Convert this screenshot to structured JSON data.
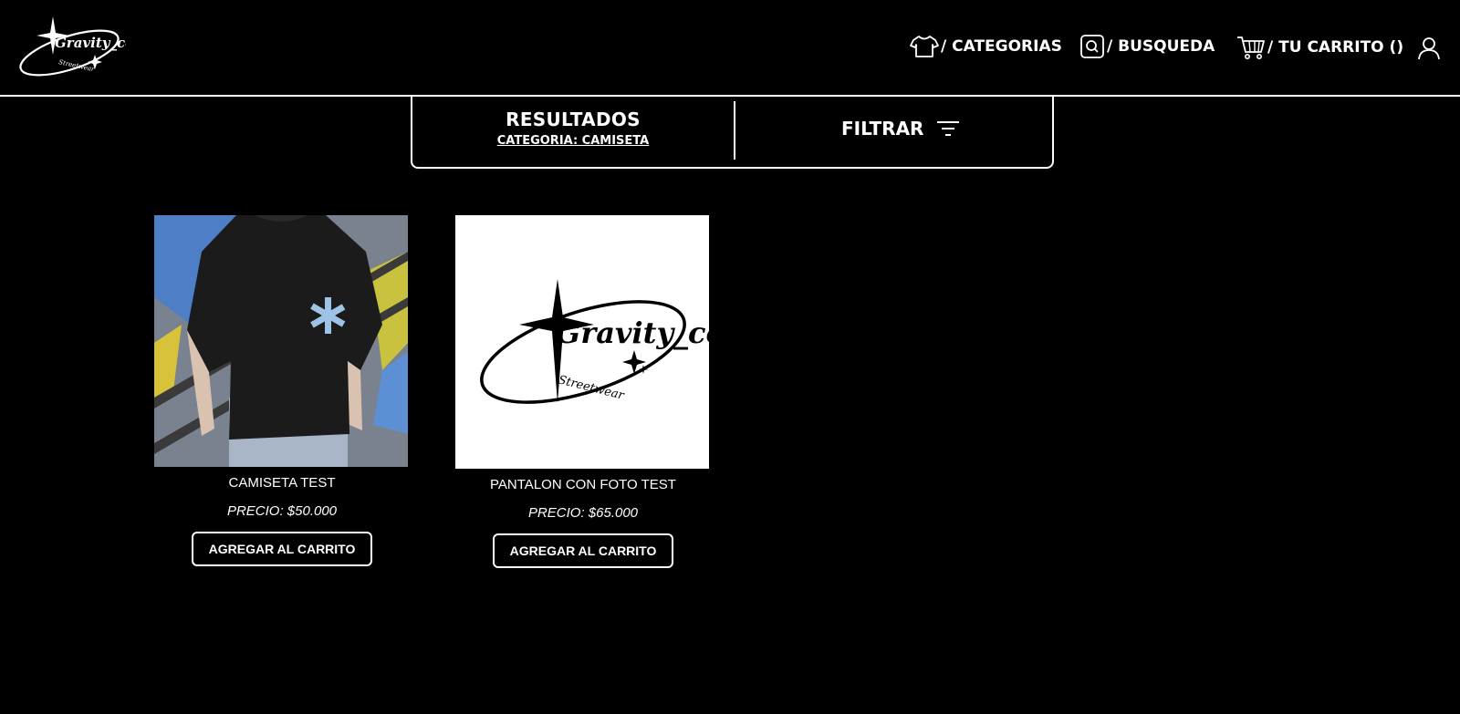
{
  "brand": {
    "logo_text": "Gravity_co",
    "logo_subtext": "Streetwear"
  },
  "nav": {
    "categories_label": "/ CATEGORIAS",
    "search_label": "/ BUSQUEDA",
    "cart_label": "/ TU CARRITO ()"
  },
  "results": {
    "title": "RESULTADOS",
    "category_label": "CATEGORIA: CAMISETA",
    "filter_label": "FILTRAR"
  },
  "products": [
    {
      "name": "CAMISETA TEST",
      "price": "PRECIO: $50.000",
      "button": "AGREGAR AL CARRITO"
    },
    {
      "name": "PANTALON CON FOTO TEST",
      "price": "PRECIO: $65.000",
      "button": "AGREGAR AL CARRITO"
    }
  ],
  "colors": {
    "background": "#000000",
    "foreground": "#ffffff"
  }
}
